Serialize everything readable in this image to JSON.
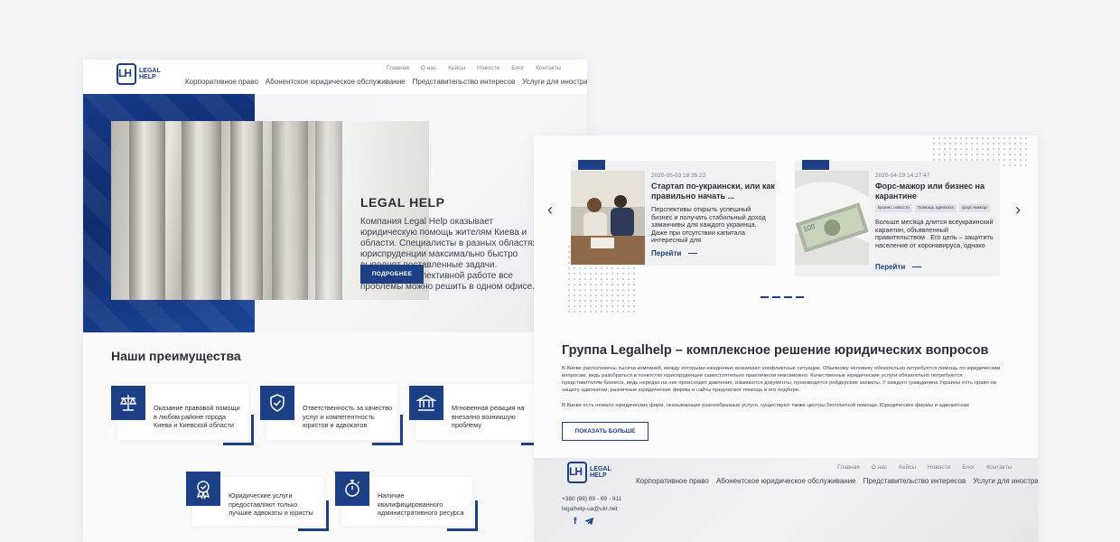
{
  "brand": {
    "mark": "LH",
    "line1": "LEGAL",
    "line2": "HELP"
  },
  "topnav": [
    "Главная",
    "О нас",
    "Кейсы",
    "Новости",
    "Блог",
    "Контакты"
  ],
  "mainnav": [
    "Корпоративное право",
    "Абонентское юридическое обслуживание",
    "Представительство интересов",
    "Услуги для иностранцев"
  ],
  "hero": {
    "title": "LEGAL HELP",
    "text": "Компания Legal Help оказывает юридическую помощь жителям Киева и области. Специалисты в разных областях юриспруденции максимально быстро выполнят поставленные задачи. Благодаря коллективной работе все проблемы можно решить в одном офисе.",
    "button": "ПОДРОБНЕЕ"
  },
  "advantages": {
    "title": "Наши преимущества",
    "items": [
      {
        "icon": "scales-icon",
        "text": "Оказание правовой помощи в любом районе города Киева и Киевской области"
      },
      {
        "icon": "shield-check-icon",
        "text": "Ответственность за качество услуг и компетентность юристов и адвокатов"
      },
      {
        "icon": "courthouse-icon",
        "text": "Мгновенная реакция на внезапно возникшую проблему"
      },
      {
        "icon": "award-badge-icon",
        "text": "Юридические услуги предоставляют только лучшие адвокаты и юристы"
      },
      {
        "icon": "stopwatch-icon",
        "text": "Наличие квалифицированного административного ресурса"
      }
    ]
  },
  "blog": {
    "posts": [
      {
        "date": "2020-05-03 18:35:22",
        "title": "Стартап по-украински, или как правильно начать ...",
        "text": "Перспективы открыть успешный бизнес и получать стабильный доход заманчивы для каждого украинца. Даже при отсутствии капитала интересный для",
        "more": "Перейти",
        "tags": []
      },
      {
        "date": "2020-04-19 14:27:47",
        "title": "Форс-мажор или бизнес на карантине",
        "text": "Больше месяца длится всеукраинский карантин, объявленный правительством . Его цель – защитить население от коронавируса, однако вынужденная",
        "more": "Перейти",
        "tags": [
          "Бизнес новости",
          "Помощь адвоката",
          "форс-мажор"
        ]
      }
    ],
    "prev_arrow": "‹",
    "next_arrow": "›"
  },
  "group": {
    "title": "Группа Legalhelp – комплексное решение юридических вопросов",
    "paragraph1": "В Киеве расположены тысячи компаний, между которыми ежедневно возникают конфликтные ситуации. Обычному человеку обязательно потребуется помощь по юридическим вопросам, ведь разобраться в тонкостях юриспруденции самостоятельно практически невозможно. Качественные юридические услуги обязательно потребуются представителям бизнеса, ведь нередко на них происходит давление, изымаются документы, производятся рейдерские захваты. У каждого гражданина Украины есть право на защиту адвокатом, различные юридические фирмы и сайты предлагают помощь в его подборе.",
    "paragraph2": "В Киеве есть немало юридических фирм, оказывающих разнообразные услуги, существуют также центры бесплатной помощи. Юридические фирмы и адвокатские",
    "button": "ПОКАЗАТЬ БОЛЬШЕ"
  },
  "footer": {
    "phone": "+380 (98) 89 - 69 - 911",
    "email": "legalhelp-ua@ukr.net",
    "social": [
      "facebook-icon",
      "telegram-icon"
    ]
  },
  "colors": {
    "brand": "#1d3f86",
    "text": "#2a2f3a",
    "background": "#f3f4f7"
  }
}
